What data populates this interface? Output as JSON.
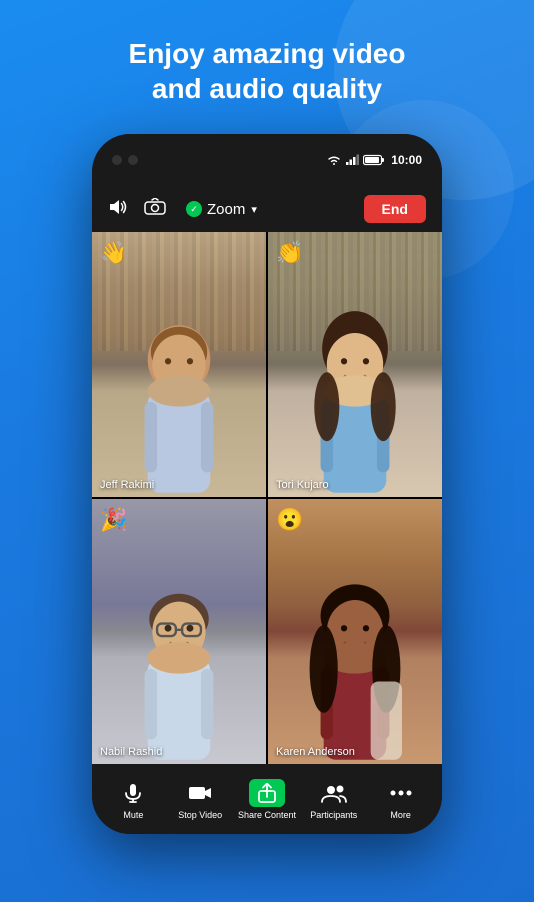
{
  "headline": {
    "line1": "Enjoy amazing video",
    "line2": "and audio quality"
  },
  "status_bar": {
    "time": "10:00"
  },
  "meeting_toolbar": {
    "zoom_label": "Zoom",
    "end_label": "End"
  },
  "participants": [
    {
      "id": "jeff",
      "name": "Jeff Rakimi",
      "emoji": "👋",
      "active_speaker": false
    },
    {
      "id": "tori",
      "name": "Tori Kujaro",
      "emoji": "👏",
      "active_speaker": true
    },
    {
      "id": "nabil",
      "name": "Nabil Rashid",
      "emoji": "🎉",
      "active_speaker": false
    },
    {
      "id": "karen",
      "name": "Karen Anderson",
      "emoji": "😮",
      "active_speaker": false
    }
  ],
  "bottom_toolbar": {
    "buttons": [
      {
        "id": "mute",
        "label": "Mute",
        "icon": "🎤"
      },
      {
        "id": "stop-video",
        "label": "Stop Video",
        "icon": "📹"
      },
      {
        "id": "share-content",
        "label": "Share Content",
        "icon": "↑"
      },
      {
        "id": "participants",
        "label": "Participants",
        "icon": "👥"
      },
      {
        "id": "more",
        "label": "More",
        "icon": "···"
      }
    ]
  }
}
